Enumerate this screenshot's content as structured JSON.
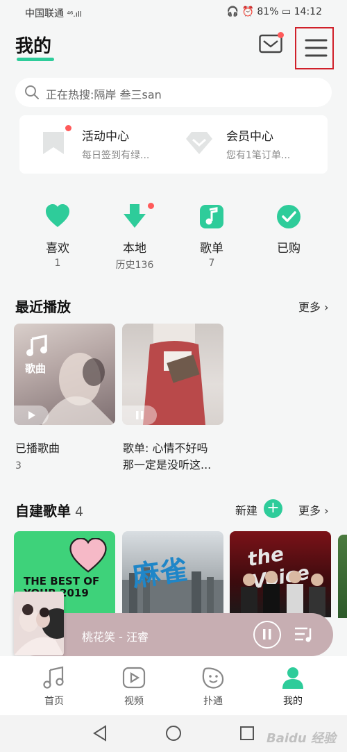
{
  "status": {
    "carrier": "中国联通",
    "signal": "⁴⁶.ıll",
    "battery": "81%",
    "time": "14:12"
  },
  "header": {
    "title": "我的",
    "mail_icon": "mail-icon",
    "menu_icon": "menu-icon"
  },
  "search": {
    "placeholder": "正在热搜:隔岸 叁三san"
  },
  "promo": [
    {
      "title": "活动中心",
      "subtitle": "每日签到有绿...",
      "icon": "bookmark-icon"
    },
    {
      "title": "会员中心",
      "subtitle": "您有1笔订单...",
      "icon": "diamond-icon"
    }
  ],
  "quick": [
    {
      "label": "喜欢",
      "count": "1",
      "icon": "heart-icon"
    },
    {
      "label": "本地",
      "count": "历史136",
      "icon": "download-icon"
    },
    {
      "label": "歌单",
      "count": "7",
      "icon": "playlist-icon"
    },
    {
      "label": "已购",
      "count": "",
      "icon": "check-icon"
    }
  ],
  "recent": {
    "title": "最近播放",
    "more": "更多",
    "items": [
      {
        "cover_label": "歌曲",
        "title": "已播歌曲",
        "sub": "3"
      },
      {
        "title_line1": "歌单: 心情不好吗",
        "title_line2": "那一定是没听这..."
      }
    ]
  },
  "playlists": {
    "title": "自建歌单",
    "count": "4",
    "new_label": "新建",
    "more": "更多",
    "cover1_text": "THE BEST OF YOUR 2019",
    "cover2_text": "麻雀",
    "cover3_text": "the Voice"
  },
  "player": {
    "now_playing": "桃花笑 - 汪睿"
  },
  "tabs": [
    {
      "label": "首页",
      "icon": "music-note-icon"
    },
    {
      "label": "视频",
      "icon": "video-icon"
    },
    {
      "label": "扑通",
      "icon": "smile-icon"
    },
    {
      "label": "我的",
      "icon": "person-icon"
    }
  ],
  "watermark": "Baidu 经验",
  "colors": {
    "accent": "#2ecc9a",
    "player_bg": "#c7aeb2",
    "dot": "#ff5a5a"
  }
}
